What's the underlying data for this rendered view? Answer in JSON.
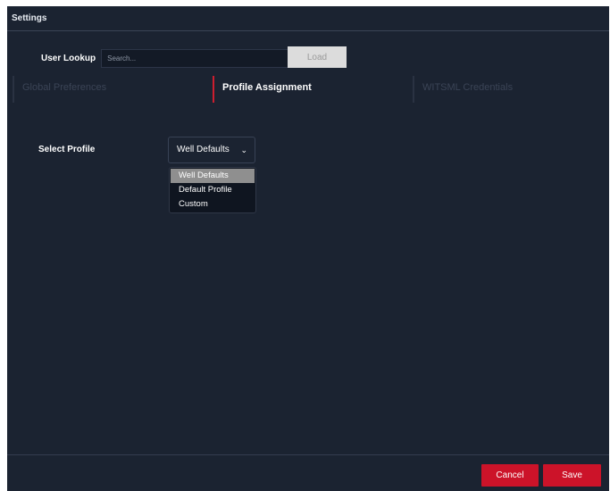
{
  "window": {
    "title": "Settings"
  },
  "lookup": {
    "label": "User Lookup",
    "placeholder": "Search...",
    "value": "",
    "load_label": "Load"
  },
  "tabs": [
    {
      "label": "Global Preferences",
      "active": false
    },
    {
      "label": "Profile Assignment",
      "active": true
    },
    {
      "label": "WITSML Credentials",
      "active": false
    }
  ],
  "profile": {
    "label": "Select Profile",
    "selected": "Well Defaults",
    "options": [
      "Well Defaults",
      "Default Profile",
      "Custom"
    ]
  },
  "footer": {
    "cancel_label": "Cancel",
    "save_label": "Save"
  },
  "colors": {
    "background": "#1b2331",
    "accent": "#cc1329",
    "active_tab_border": "#cc1e2f"
  }
}
